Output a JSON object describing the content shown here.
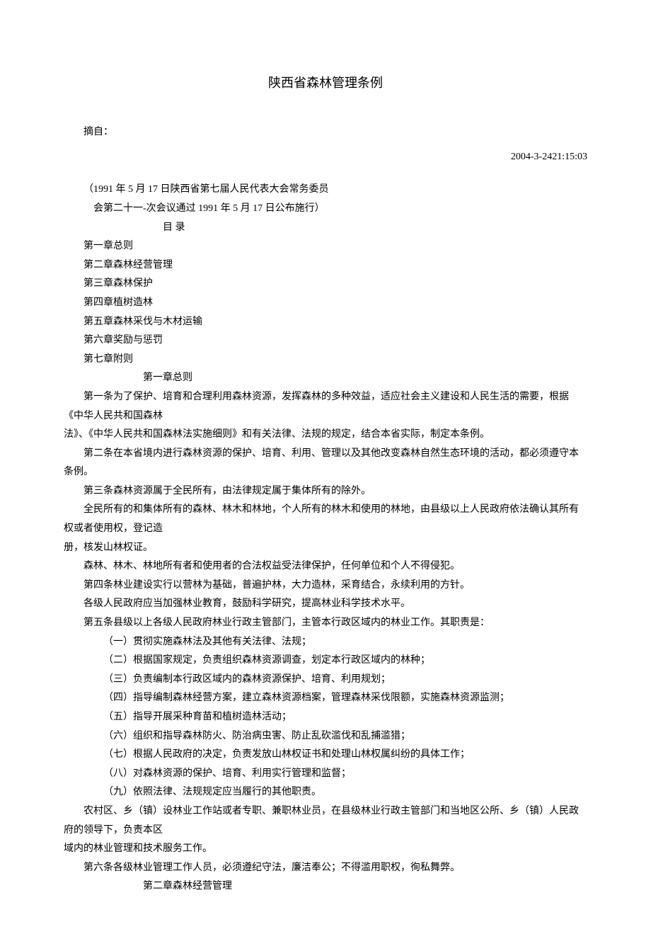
{
  "title": "陕西省森林管理条例",
  "source_label": "摘自：",
  "timestamp": "2004-3-2421:15:03",
  "enact_line1": "（1991 年 5 月 17 日陕西省第七届人民代表大会常务委员",
  "enact_line2": "会第二十一-次会议通过 1991 年 5 月 17 日公布施行）",
  "toc_label": "目 录",
  "toc": [
    "第一章总则",
    "第二章森林经营管理",
    "第三章森林保护",
    "第四章植树造林",
    "第五章森林采伐与木材运输",
    "第六章奖励与惩罚",
    "第七章附则"
  ],
  "chapter1_heading": "第一章总则",
  "art1_p1": "第一条为了保护、培育和合理利用森林资源，发挥森林的多种效益，适应社会主义建设和人民生活的需要，根据《中华人民共和国森林",
  "art1_p2": "法》、《中华人民共和国森林法实施细则》和有关法律、法规的规定，结合本省实际，制定本条例。",
  "art2": "第二条在本省境内进行森林资源的保护、培育、利用、管理以及其他改变森林自然生态环境的活动，都必须遵守本条例。",
  "art3_p1": "第三条森林资源属于全民所有，由法律规定属于集体所有的除外。",
  "art3_p2": "全民所有的和集体所有的森林、林木和林地，个人所有的林木和使用的林地，由县级以上人民政府依法确认其所有权或者使用权，登记造",
  "art3_p3": "册，核发山林权证。",
  "art3_p4": "森林、林木、林地所有者和使用者的合法权益受法律保护，任何单位和个人不得侵犯。",
  "art4_p1": "第四条林业建设实行以营林为基础，普遍护林，大力造林，采育结合，永续利用的方针。",
  "art4_p2": "各级人民政府应当加强林业教育，鼓励科学研究，提高林业科学技术水平。",
  "art5_intro": "第五条县级以上各级人民政府林业行政主管部门，主管本行政区域内的林业工作。其职责是：",
  "art5_items": [
    "（一）贯彻实施森林法及其他有关法律、法规；",
    "（二）根据国家规定，负责组织森林资源调查，划定本行政区域内的林种；",
    "（三）负责编制本行政区域内的森林资源保护、培育、利用规划；",
    "（四）指导编制森林经营方案，建立森林资源档案，管理森林采伐限额，实施森林资源监测；",
    "（五）指导开展采种育苗和植树造林活动；",
    "（六）组织和指导森林防火、防治病虫害、防止乱砍滥伐和乱捕滥猎；",
    "（七）根据人民政府的决定，负责发放山林权证书和处理山林权属纠纷的具体工作；",
    "（八）对森林资源的保护、培育、利用实行管理和监督；",
    "（九）依照法律、法规规定应当履行的其他职责。"
  ],
  "art5_tail1": "农村区、乡（镇）设林业工作站或者专职、兼职林业员，在县级林业行政主管部门和当地区公所、乡（镇）人民政府的领导下，负责本区",
  "art5_tail2": "域内的林业管理和技术服务工作。",
  "art6": "第六条各级林业管理工作人员，必须遵纪守法，廉洁奉公；不得滥用职权，徇私舞弊。",
  "chapter2_heading": "第二章森林经营管理"
}
